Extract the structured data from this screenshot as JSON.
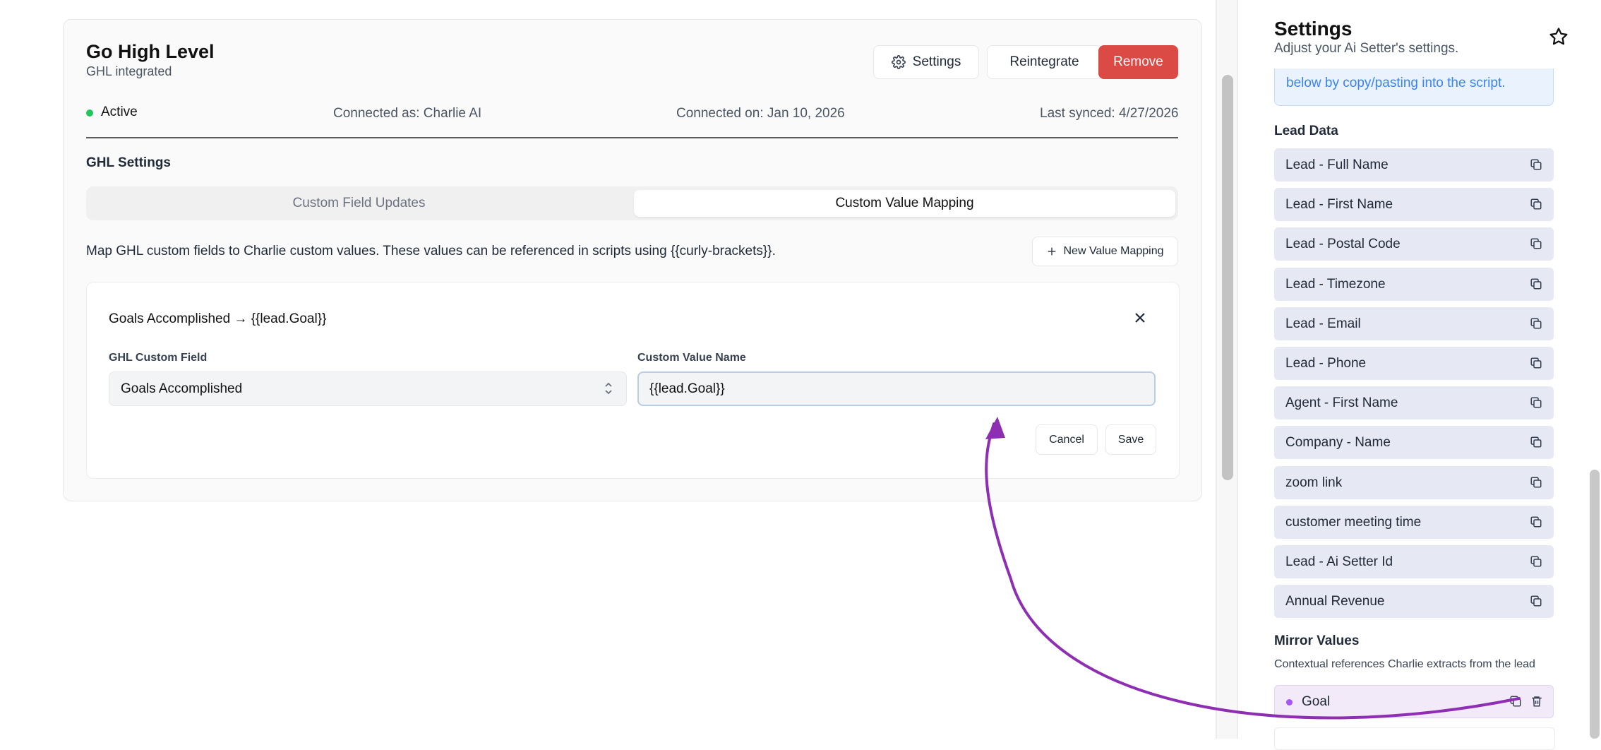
{
  "integration": {
    "title": "Go High Level",
    "subtitle": "GHL integrated",
    "buttons": {
      "settings": "Settings",
      "reintegrate": "Reintegrate",
      "remove": "Remove"
    },
    "status": "Active",
    "connected_as": "Connected as: Charlie AI",
    "connected_on": "Connected on: Jan 10, 2026",
    "last_synced": "Last synced: 4/27/2026"
  },
  "ghl_settings": {
    "title": "GHL Settings",
    "tabs": [
      "Custom Field Updates",
      "Custom Value Mapping"
    ],
    "active_tab": "Custom Value Mapping",
    "description": "Map GHL custom fields to Charlie custom values. These values can be referenced in scripts using {{curly-brackets}}.",
    "new_mapping_label": "New Value Mapping"
  },
  "mapping": {
    "title": "Goals Accomplished → {{lead.Goal}}",
    "ghl_field_label": "GHL Custom Field",
    "ghl_field_value": "Goals Accomplished",
    "custom_value_label": "Custom Value Name",
    "custom_value_value": "{{lead.Goal}}",
    "cancel_label": "Cancel",
    "save_label": "Save"
  },
  "panel": {
    "title": "Settings",
    "subtitle": "Adjust your Ai Setter's settings.",
    "note": "below by copy/pasting into the script.",
    "lead_data_title": "Lead Data",
    "lead_data": [
      "Lead - Full Name",
      "Lead - First Name",
      "Lead - Postal Code",
      "Lead - Timezone",
      "Lead - Email",
      "Lead - Phone",
      "Agent - First Name",
      "Company - Name",
      "zoom link",
      "customer meeting time",
      "Lead - Ai Setter Id",
      "Annual Revenue"
    ],
    "mirror_title": "Mirror Values",
    "mirror_desc": "Contextual references Charlie extracts from the lead",
    "mirror_items": [
      "Goal"
    ]
  },
  "colors": {
    "remove": "#dc4a45",
    "active": "#22c55e",
    "arrow": "#8e2fb3",
    "chip": "#e6e8f4",
    "note": "#3b82f6"
  }
}
